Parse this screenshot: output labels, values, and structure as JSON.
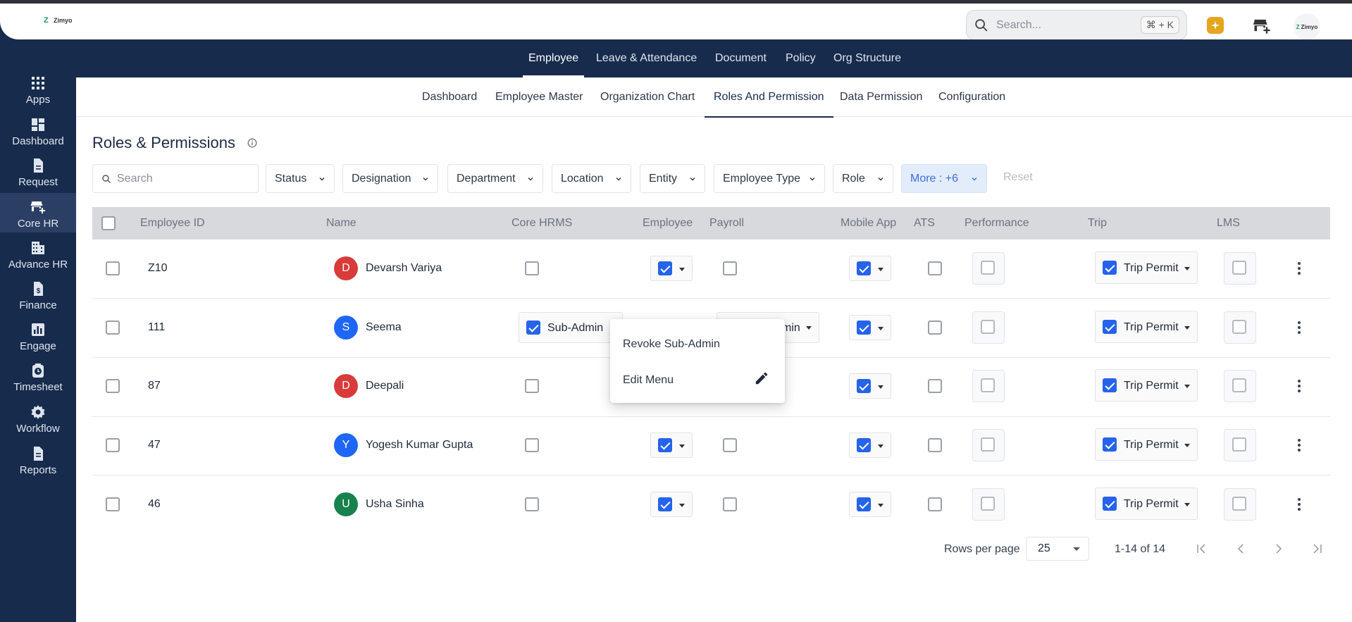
{
  "app": {
    "logo_text": "Zimyo",
    "logo_mark": "Z"
  },
  "header": {
    "search_placeholder": "Search...",
    "shortcut": "⌘ + K",
    "icons": [
      "sparkle-icon",
      "store-add-icon"
    ],
    "avatar_text": "Zimyo"
  },
  "sidebar": {
    "items": [
      {
        "label": "Apps",
        "icon": "apps-grid-icon"
      },
      {
        "label": "Dashboard",
        "icon": "dashboard-icon"
      },
      {
        "label": "Request",
        "icon": "document-icon"
      },
      {
        "label": "Core HR",
        "icon": "store-add-icon",
        "active": true
      },
      {
        "label": "Advance HR",
        "icon": "building-icon"
      },
      {
        "label": "Finance",
        "icon": "finance-doc-icon"
      },
      {
        "label": "Engage",
        "icon": "bar-chart-icon"
      },
      {
        "label": "Timesheet",
        "icon": "timesheet-icon"
      },
      {
        "label": "Workflow",
        "icon": "gear-icon"
      },
      {
        "label": "Reports",
        "icon": "report-icon"
      }
    ]
  },
  "main_tabs": [
    "Employee",
    "Leave & Attendance",
    "Document",
    "Policy",
    "Org Structure"
  ],
  "sub_tabs": [
    "Dashboard",
    "Employee Master",
    "Organization Chart",
    "Roles And Permission",
    "Data Permission",
    "Configuration"
  ],
  "page": {
    "title": "Roles & Permissions"
  },
  "filters": {
    "search_placeholder": "Search",
    "items": [
      "Status",
      "Designation",
      "Department",
      "Location",
      "Entity",
      "Employee Type",
      "Role"
    ],
    "more": "More : +6",
    "reset": "Reset"
  },
  "table": {
    "headers": [
      "Employee ID",
      "Name",
      "Core HRMS",
      "Employee",
      "Payroll",
      "Mobile App",
      "ATS",
      "Performance",
      "Trip",
      "LMS"
    ],
    "rows": [
      {
        "id": "Z10",
        "name": "Devarsh Variya",
        "initial": "D",
        "avatar_color": "#d93a3a",
        "employee": true,
        "payroll_label": "",
        "trip": "Trip Permit"
      },
      {
        "id": "111",
        "name": "Seema",
        "initial": "S",
        "avatar_color": "#1e66f5",
        "core_hrms": "Sub-Admin",
        "payroll_label": "min",
        "trip": "Trip Permit"
      },
      {
        "id": "87",
        "name": "Deepali",
        "initial": "D",
        "avatar_color": "#d93a3a",
        "trip": "Trip Permit"
      },
      {
        "id": "47",
        "name": "Yogesh Kumar Gupta",
        "initial": "Y",
        "avatar_color": "#1e66f5",
        "employee": true,
        "trip": "Trip Permit"
      },
      {
        "id": "46",
        "name": "Usha Sinha",
        "initial": "U",
        "avatar_color": "#17824e",
        "employee": true,
        "trip": "Trip Permit"
      }
    ]
  },
  "context_menu": {
    "items": [
      "Revoke Sub-Admin",
      "Edit Menu"
    ]
  },
  "pagination": {
    "rows_per_page_label": "Rows per page",
    "rows_per_page": "25",
    "range": "1-14 of 14"
  },
  "colors": {
    "navy": "#172b4d",
    "primary": "#2563eb",
    "accent_star": "#e6a51e"
  }
}
